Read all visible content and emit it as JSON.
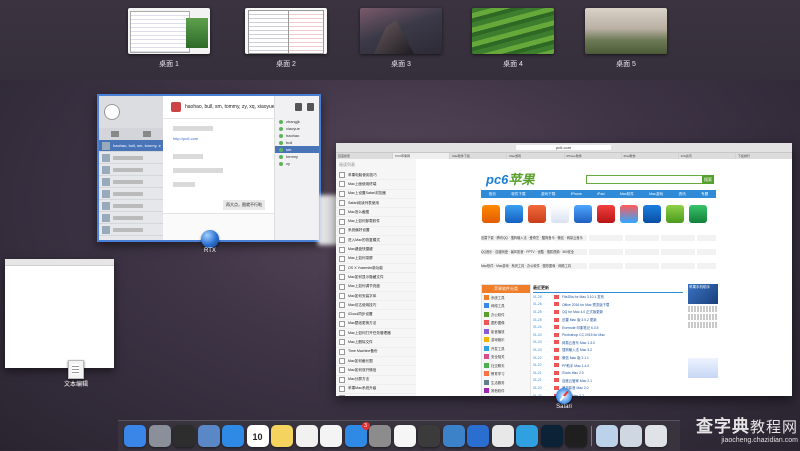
{
  "spaces": [
    {
      "label": "桌面 1"
    },
    {
      "label": "桌面 2"
    },
    {
      "label": "桌面 3"
    },
    {
      "label": "桌面 4"
    },
    {
      "label": "桌面 5"
    }
  ],
  "windows": {
    "rtx": {
      "app_label": "RTX",
      "chat_title": "haohao, bull, sm, tommy, zy, xq, xiaoyue",
      "link_text": "http://pc6.com",
      "message": "再大点，图就不行啦",
      "members": [
        "zhangjk",
        "xiaoyue",
        "haohao",
        "bull",
        "sm",
        "tommy",
        "zy"
      ]
    },
    "textedit": {
      "app_label": "文本编辑"
    },
    "safari": {
      "app_label": "Safari",
      "url": "pc6.com",
      "tabs": [
        "百度搜索",
        "PC6苹果网",
        "Mac软件下载",
        "Mac游戏",
        "iPhone软件",
        "iPad软件",
        "iOS资讯",
        "下载排行"
      ],
      "sidebar_heading": "阅读列表",
      "sidebar_items": [
        "苹果电脑使用技巧",
        "Mac上面使用终端",
        "Mac上设置Safari浏览器",
        "Safari阅读列表使用",
        "Mac怎么截图",
        "Mac上如何卸载软件",
        "系统偏好设置",
        "进入Mac的恢复模式",
        "Mac键盘快捷键",
        "Mac上如何录屏",
        "OS X Yosemite新功能",
        "Mac如何显示隐藏文件",
        "Mac上如何调节亮度",
        "Mac如何安装字体",
        "Mac访达使用技巧",
        "iCloud同步设置",
        "Mac壁纸更换方法",
        "Mac上如何打开任务管理器",
        "Mac上删除文件",
        "Time Machine备份",
        "Mac如何截长图",
        "Mac如何双开微信",
        "Mac分屏方法",
        "苹果Mac系统升级",
        "Mac常用软件推荐",
        "Launchpad使用",
        "Mac上如何打开NTFS",
        "Mac使用技巧大全"
      ],
      "site": {
        "logo_a": "pc6",
        "logo_b": "苹果",
        "search_button": "搜索",
        "nav": [
          "首页",
          "软件下载",
          "游戏下载",
          "iPhone",
          "iPad",
          "Mac软件",
          "Mac游戏",
          "资讯",
          "专题"
        ],
        "sub_row_1": "迅雷下载 · 腾讯QQ · 搜狗输入法 · 爱奇艺 · 酷狗音乐 · 微信 · 网易云音乐",
        "sub_row_2": "QQ音乐 · 百度网盘 · 暴风影音 · PPTV · 优酷 · 搜狐视频 · 360安全",
        "sub_row_3": "Mac软件 · Mac游戏 · 系统工具 · 办公软件 · 图形图像 · 网络工具",
        "left_box_title": "苹果软件分类",
        "left_box_items": [
          "系统工具",
          "网络工具",
          "办公软件",
          "图形图像",
          "影音播放",
          "游戏娱乐",
          "开发工具",
          "安全相关",
          "社交聊天",
          "教育学习",
          "生活服务",
          "其他软件"
        ],
        "mid_title": "最近更新",
        "news": [
          {
            "date": "01-26",
            "text": "FileZilla for Mac 3.10.1 发布"
          },
          {
            "date": "01-26",
            "text": "Office 2016 for Mac 预览版下载"
          },
          {
            "date": "01-25",
            "text": "QQ for Mac 4.0 正式版更新"
          },
          {
            "date": "01-25",
            "text": "迅雷 Mac 版 3.0.2 更新"
          },
          {
            "date": "01-24",
            "text": "Evernote 印象笔记 6.0.5"
          },
          {
            "date": "01-24",
            "text": "Photoshop CC 2015 for Mac"
          },
          {
            "date": "01-23",
            "text": "网易云音乐 Mac 1.3.0"
          },
          {
            "date": "01-23",
            "text": "搜狗输入法 Mac 3.2"
          },
          {
            "date": "01-22",
            "text": "微信 Mac 版 1.1.1"
          },
          {
            "date": "01-22",
            "text": "PP助手 Mac 1.4.0"
          },
          {
            "date": "01-21",
            "text": "iTools Mac 2.0"
          },
          {
            "date": "01-21",
            "text": "百度云管家 Mac 2.1"
          },
          {
            "date": "01-20",
            "text": "暴风影音 Mac 2.0"
          },
          {
            "date": "01-20",
            "text": "PPTV Mac 2.2"
          }
        ],
        "ad_text": "苹果手机助手"
      }
    }
  },
  "dock": [
    {
      "name": "finder-icon",
      "color": "#3a86e8"
    },
    {
      "name": "launchpad-icon",
      "color": "#8a8f99"
    },
    {
      "name": "mission-control-icon",
      "color": "#2d2d2d"
    },
    {
      "name": "preview-icon",
      "color": "#5a88c7"
    },
    {
      "name": "safari-icon",
      "color": "#2f8ae6"
    },
    {
      "name": "calendar-icon",
      "color": "#ffffff"
    },
    {
      "name": "notes-icon",
      "color": "#f4d35e"
    },
    {
      "name": "photos-icon",
      "color": "#f1f1f1"
    },
    {
      "name": "music-icon",
      "color": "#f4f4f4"
    },
    {
      "name": "app-store-icon",
      "color": "#2f8ae6"
    },
    {
      "name": "system-preferences-icon",
      "color": "#8c8c8c"
    },
    {
      "name": "textedit-icon",
      "color": "#f6f6f6"
    },
    {
      "name": "quicktime-icon",
      "color": "#3b3b3b"
    },
    {
      "name": "xcode-icon",
      "color": "#3c82c8"
    },
    {
      "name": "rtx-icon",
      "color": "#2a6fcf"
    },
    {
      "name": "chrome-icon",
      "color": "#e8e8e8"
    },
    {
      "name": "weather-icon",
      "color": "#2fa0e0"
    },
    {
      "name": "photoshop-icon",
      "color": "#0b2237"
    },
    {
      "name": "terminal-icon",
      "color": "#1f1f1f"
    },
    {
      "name": "documents-folder-icon",
      "color": "#bcd2ea"
    },
    {
      "name": "downloads-folder-icon",
      "color": "#cfd7e3"
    },
    {
      "name": "trash-icon",
      "color": "#dfe3e8"
    }
  ],
  "dock_labels": {
    "calendar_day": "10",
    "app_store_badge": "3"
  },
  "watermark": {
    "main_a": "查字典",
    "main_b": "教程网",
    "url": "jiaocheng.chazidian.com"
  }
}
